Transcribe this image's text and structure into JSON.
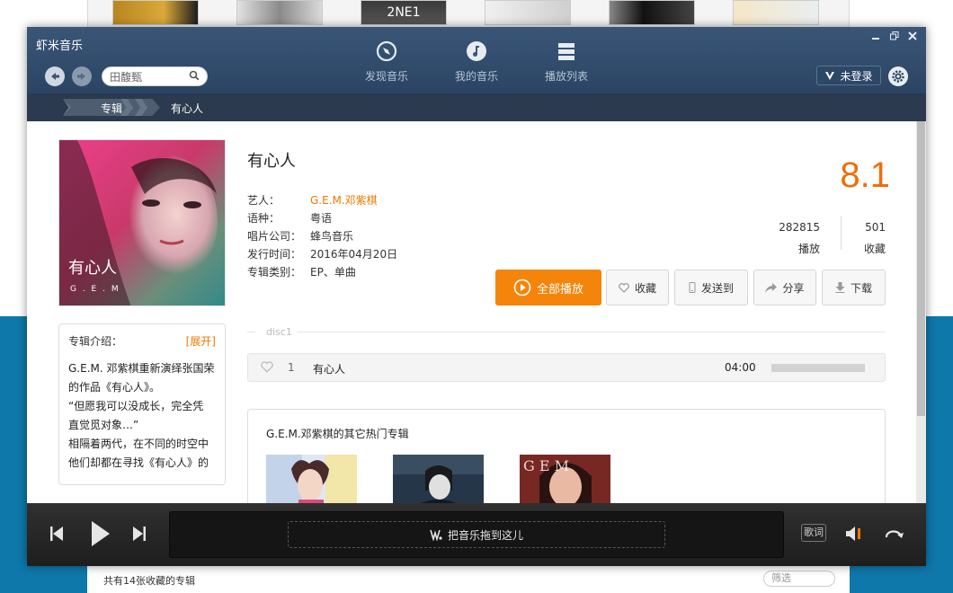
{
  "background": {
    "footer_count": "共有14张收藏的专辑",
    "filter_placeholder": "筛选"
  },
  "app": {
    "title": "虾米音乐",
    "search_value": "田馥甄"
  },
  "nav_tabs": [
    {
      "label": "发现音乐",
      "icon": "compass-icon"
    },
    {
      "label": "我的音乐",
      "icon": "music-note-icon"
    },
    {
      "label": "播放列表",
      "icon": "playlist-icon"
    }
  ],
  "user": {
    "login_label": "未登录"
  },
  "breadcrumb": {
    "section": "专辑",
    "current": "有心人"
  },
  "album": {
    "title": "有心人",
    "cover_text": "有心人",
    "cover_subtext": "G . E . M",
    "meta": [
      {
        "key": "艺人：",
        "value": "G.E.M.邓紫棋"
      },
      {
        "key": "语种：",
        "value": "粤语"
      },
      {
        "key": "唱片公司：",
        "value": "蜂鸟音乐"
      },
      {
        "key": "发行时间：",
        "value": "2016年04月20日"
      },
      {
        "key": "专辑类别：",
        "value": "EP、单曲"
      }
    ],
    "score": "8.1",
    "plays_count": "282815",
    "plays_label": "播放",
    "favs_count": "501",
    "favs_label": "收藏"
  },
  "actions": {
    "play_all": "全部播放",
    "favorite": "收藏",
    "send_to": "发送到",
    "share": "分享",
    "download": "下载"
  },
  "intro": {
    "label": "专辑介绍：",
    "expand": "[展开]",
    "lines": [
      "G.E.M. 邓紫棋重新演绎张国荣",
      "的作品《有心人》。",
      "“但愿我可以没成长，完全凭",
      "直觉觅对象…”",
      "相隔着两代，在不同的时空中",
      "他们却都在寻找《有心人》的"
    ]
  },
  "tracklist": {
    "disc_label": "disc1",
    "tracks": [
      {
        "number": "1",
        "name": "有心人",
        "duration": "04:00"
      }
    ]
  },
  "other_albums": {
    "heading": "G.E.M.邓紫棋的其它热门专辑"
  },
  "player": {
    "drop_hint": "把音乐拖到这儿",
    "lyrics_label": "歌词"
  }
}
